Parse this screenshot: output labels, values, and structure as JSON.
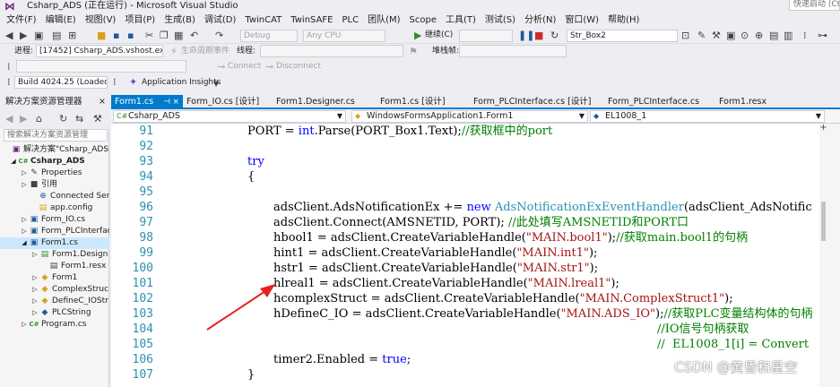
{
  "window": {
    "title": "Csharp_ADS (正在运行) - Microsoft Visual Studio",
    "quick_launch_placeholder": "快速启动 (Ctr"
  },
  "menu": [
    "文件(F)",
    "编辑(E)",
    "视图(V)",
    "项目(P)",
    "生成(B)",
    "调试(D)",
    "TwinCAT",
    "TwinSAFE",
    "PLC",
    "团队(M)",
    "Scope",
    "工具(T)",
    "测试(S)",
    "分析(N)",
    "窗口(W)",
    "帮助(H)"
  ],
  "toolbar": {
    "config": "Debug",
    "platform": "Any CPU",
    "continue_label": "继续(C)",
    "find_combo": "Str_Box2",
    "process_label": "进程:",
    "process_value": "[17452] Csharp_ADS.vshost.exe",
    "lifecycle_label": "生命周期事件",
    "thread_label": "线程:",
    "stack_label": "堆栈帧:",
    "connect_label": "Connect",
    "disconnect_label": "Disconnect",
    "build_label": "Build 4024.25 (Loaded)",
    "insights_label": "Application Insights"
  },
  "solution_explorer": {
    "header": "解决方案资源管理器",
    "search_placeholder": "搜索解决方案资源管理",
    "items": [
      {
        "label": "解决方案\"Csharp_ADS\"(",
        "icon": "solution-icon",
        "bold": false
      },
      {
        "label": "Csharp_ADS",
        "icon": "csharp-project-icon",
        "bold": true
      },
      {
        "label": "Properties",
        "icon": "wrench-icon",
        "bold": false
      },
      {
        "label": "引用",
        "icon": "references-icon",
        "bold": false
      },
      {
        "label": "Connected Servic",
        "icon": "connected-services-icon",
        "bold": false
      },
      {
        "label": "app.config",
        "icon": "config-file-icon",
        "bold": false
      },
      {
        "label": "Form_IO.cs",
        "icon": "form-icon",
        "bold": false
      },
      {
        "label": "Form_PLCInterfac",
        "icon": "form-icon",
        "bold": false
      },
      {
        "label": "Form1.cs",
        "icon": "form-icon",
        "bold": false,
        "selected": true
      },
      {
        "label": "Form1.Design",
        "icon": "cs-file-icon",
        "bold": false
      },
      {
        "label": "Form1.resx",
        "icon": "resx-file-icon",
        "bold": false
      },
      {
        "label": "Form1",
        "icon": "class-icon",
        "bold": false
      },
      {
        "label": "ComplexStruc",
        "icon": "class-icon",
        "bold": false
      },
      {
        "label": "DefineC_IOStr",
        "icon": "class-icon",
        "bold": false
      },
      {
        "label": "PLCString",
        "icon": "struct-icon",
        "bold": false
      },
      {
        "label": "Program.cs",
        "icon": "cs-file-icon",
        "bold": false
      }
    ]
  },
  "tabs": [
    {
      "label": "Form1.cs",
      "active": true
    },
    {
      "label": "Form_IO.cs [设计]",
      "active": false
    },
    {
      "label": "Form1.Designer.cs",
      "active": false
    },
    {
      "label": "Form1.cs [设计]",
      "active": false
    },
    {
      "label": "Form_PLCInterface.cs [设计]",
      "active": false
    },
    {
      "label": "Form_PLCInterface.cs",
      "active": false
    },
    {
      "label": "Form1.resx",
      "active": false
    }
  ],
  "navbar": {
    "project": "Csharp_ADS",
    "class": "WindowsFormsApplication1.Form1",
    "member": "EL1008_1"
  },
  "code": {
    "line_numbers": [
      "91",
      "92",
      "93",
      "94",
      "95",
      "96",
      "97",
      "98",
      "99",
      "100",
      "101",
      "102",
      "103",
      "104",
      "105",
      "106",
      "107"
    ],
    "lines": [
      [
        {
          "t": "PORT = ",
          "c": "pl"
        },
        {
          "t": "int",
          "c": "kw"
        },
        {
          "t": ".Parse(PORT_Box1.Text);",
          "c": "pl"
        },
        {
          "t": "//获取框中的port",
          "c": "cm"
        }
      ],
      [],
      [
        {
          "t": "try",
          "c": "kw"
        }
      ],
      [
        {
          "t": "{",
          "c": "pl"
        }
      ],
      [],
      [
        {
          "t": "adsClient.AdsNotificationEx += ",
          "c": "pl"
        },
        {
          "t": "new",
          "c": "kw"
        },
        {
          "t": " ",
          "c": "pl"
        },
        {
          "t": "AdsNotificationExEventHandler",
          "c": "ty"
        },
        {
          "t": "(adsClient_AdsNotific",
          "c": "pl"
        }
      ],
      [
        {
          "t": "adsClient.Connect(AMSNETID, PORT); ",
          "c": "pl"
        },
        {
          "t": "//此处填写AMSNETID和PORT口",
          "c": "cm"
        }
      ],
      [
        {
          "t": "hbool1 = adsClient.CreateVariableHandle(",
          "c": "pl"
        },
        {
          "t": "\"MAIN.bool1\"",
          "c": "st"
        },
        {
          "t": ");",
          "c": "pl"
        },
        {
          "t": "//获取main.bool1的句柄",
          "c": "cm"
        }
      ],
      [
        {
          "t": "hint1 = adsClient.CreateVariableHandle(",
          "c": "pl"
        },
        {
          "t": "\"MAIN.int1\"",
          "c": "st"
        },
        {
          "t": ");",
          "c": "pl"
        }
      ],
      [
        {
          "t": "hstr1 = adsClient.CreateVariableHandle(",
          "c": "pl"
        },
        {
          "t": "\"MAIN.str1\"",
          "c": "st"
        },
        {
          "t": ");",
          "c": "pl"
        }
      ],
      [
        {
          "t": "hlreal1 = adsClient.CreateVariableHandle(",
          "c": "pl"
        },
        {
          "t": "\"MAIN.lreal1\"",
          "c": "st"
        },
        {
          "t": ");",
          "c": "pl"
        }
      ],
      [
        {
          "t": "hcomplexStruct = adsClient.CreateVariableHandle(",
          "c": "pl"
        },
        {
          "t": "\"MAIN.ComplexStruct1\"",
          "c": "st"
        },
        {
          "t": ");",
          "c": "pl"
        }
      ],
      [
        {
          "t": "hDefineC_IO = adsClient.CreateVariableHandle(",
          "c": "pl"
        },
        {
          "t": "\"MAIN.ADS_IO\"",
          "c": "st"
        },
        {
          "t": ");",
          "c": "pl"
        },
        {
          "t": "//获取PLC变量结构体的句柄",
          "c": "cm"
        }
      ],
      [
        {
          "t": "//IO信号句柄获取",
          "c": "cm"
        }
      ],
      [
        {
          "t": "//  EL1008_1[i] = Convert",
          "c": "cm"
        }
      ],
      [
        {
          "t": "timer2.Enabled = ",
          "c": "pl"
        },
        {
          "t": "true",
          "c": "kw"
        },
        {
          "t": ";",
          "c": "pl"
        }
      ],
      [
        {
          "t": "}",
          "c": "pl"
        }
      ]
    ],
    "indent": [
      0,
      0,
      0,
      0,
      0,
      1,
      1,
      1,
      1,
      1,
      1,
      1,
      1,
      2,
      2,
      1,
      0
    ]
  },
  "watermark": "CSDN @黄昏和星空",
  "colors": {
    "accent": "#007acc",
    "arrow": "#e8231b"
  }
}
